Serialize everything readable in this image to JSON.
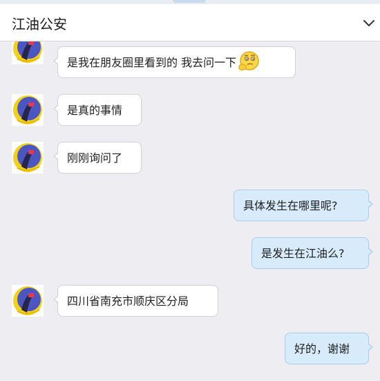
{
  "header": {
    "title": "江油公安"
  },
  "icons": {
    "collapse": "chevron-down-icon",
    "contact_avatar": "contact-avatar",
    "emoji": "thinking-emoji-icon"
  },
  "colors": {
    "incoming_bubble": "#ffffff",
    "outgoing_bubble": "#d7ebfb",
    "chat_background": "#eeeef2"
  },
  "messages": [
    {
      "side": "in",
      "text": "是我在朋友圈里看到的 我去问一下",
      "emoji": "thinking-emoji"
    },
    {
      "side": "in",
      "text": "是真的事情"
    },
    {
      "side": "in",
      "text": "刚刚询问了"
    },
    {
      "side": "out",
      "text": "具体发生在哪里呢?"
    },
    {
      "side": "out",
      "text": "是发生在江油么?"
    },
    {
      "side": "in",
      "text": "四川省南充市顺庆区分局"
    },
    {
      "side": "out",
      "text": "好的，谢谢"
    }
  ]
}
